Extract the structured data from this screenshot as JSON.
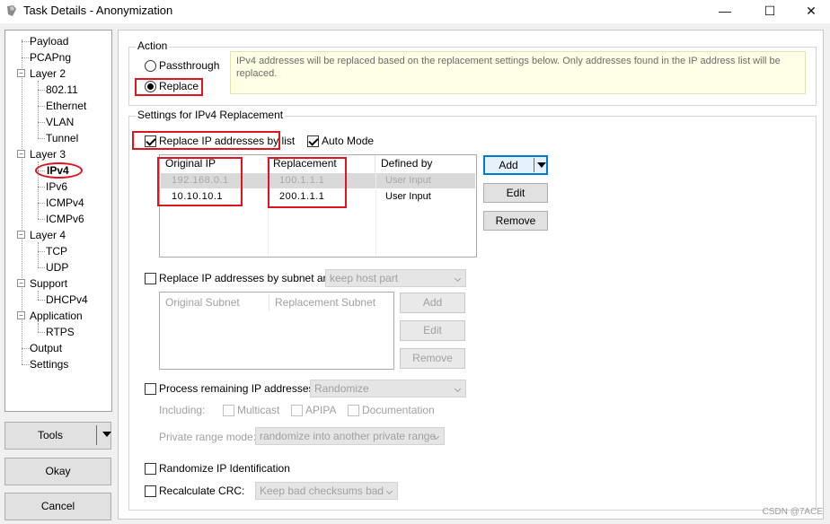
{
  "window": {
    "title": "Task Details - Anonymization",
    "minimize_glyph": "—",
    "maximize_glyph": "☐",
    "close_glyph": "✕"
  },
  "tree": {
    "items": [
      {
        "label": "Payload"
      },
      {
        "label": "PCAPng"
      },
      {
        "label": "Layer 2"
      },
      {
        "label": "802.11"
      },
      {
        "label": "Ethernet"
      },
      {
        "label": "VLAN"
      },
      {
        "label": "Tunnel"
      },
      {
        "label": "Layer 3"
      },
      {
        "label": "IPv4",
        "selected": true
      },
      {
        "label": "IPv6"
      },
      {
        "label": "ICMPv4"
      },
      {
        "label": "ICMPv6"
      },
      {
        "label": "Layer 4"
      },
      {
        "label": "TCP"
      },
      {
        "label": "UDP"
      },
      {
        "label": "Support"
      },
      {
        "label": "DHCPv4"
      },
      {
        "label": "Application"
      },
      {
        "label": "RTPS"
      },
      {
        "label": "Output"
      },
      {
        "label": "Settings"
      }
    ]
  },
  "left_buttons": {
    "tools": "Tools",
    "okay": "Okay",
    "cancel": "Cancel"
  },
  "action": {
    "group_label": "Action",
    "passthrough": "Passthrough",
    "replace": "Replace",
    "selected": "Replace",
    "info": "IPv4 addresses will be replaced based on the replacement settings below. Only addresses found in the IP address list will be replaced."
  },
  "settings": {
    "group_label": "Settings for IPv4 Replacement",
    "replace_by_list": {
      "label": "Replace IP addresses by list",
      "checked": true
    },
    "auto_mode": {
      "label": "Auto Mode",
      "checked": true
    },
    "ip_table": {
      "columns": [
        "Original IP",
        "Replacement",
        "Defined by"
      ],
      "rows": [
        {
          "original": "192.168.0.1",
          "replacement": "100.1.1.1",
          "defined_by": "User Input",
          "selected": true
        },
        {
          "original": "10.10.10.1",
          "replacement": "200.1.1.1",
          "defined_by": "User Input",
          "selected": false
        }
      ]
    },
    "list_buttons": {
      "add": "Add",
      "edit": "Edit",
      "remove": "Remove"
    },
    "replace_by_subnet": {
      "label": "Replace IP addresses by subnet and",
      "checked": false,
      "mode": "keep host part"
    },
    "subnet_table": {
      "columns": [
        "Original Subnet",
        "Replacement Subnet"
      ]
    },
    "subnet_buttons": {
      "add": "Add",
      "edit": "Edit",
      "remove": "Remove"
    },
    "process_remaining": {
      "label": "Process remaining IP addresses:",
      "checked": false,
      "mode": "Randomize"
    },
    "including": {
      "label": "Including:",
      "multicast": "Multicast",
      "apipa": "APIPA",
      "documentation": "Documentation"
    },
    "private_range": {
      "label": "Private range mode:",
      "mode": "randomize into another private range"
    },
    "randomize_ip_id": {
      "label": "Randomize IP Identification",
      "checked": false
    },
    "recalc_crc": {
      "label": "Recalculate CRC:",
      "checked": false,
      "mode": "Keep bad checksums bad"
    }
  },
  "watermark": "CSDN @7ACE",
  "colors": {
    "highlight_red": "#e0141e",
    "info_bg": "#ffffe6",
    "accent_blue": "#0078d7"
  }
}
